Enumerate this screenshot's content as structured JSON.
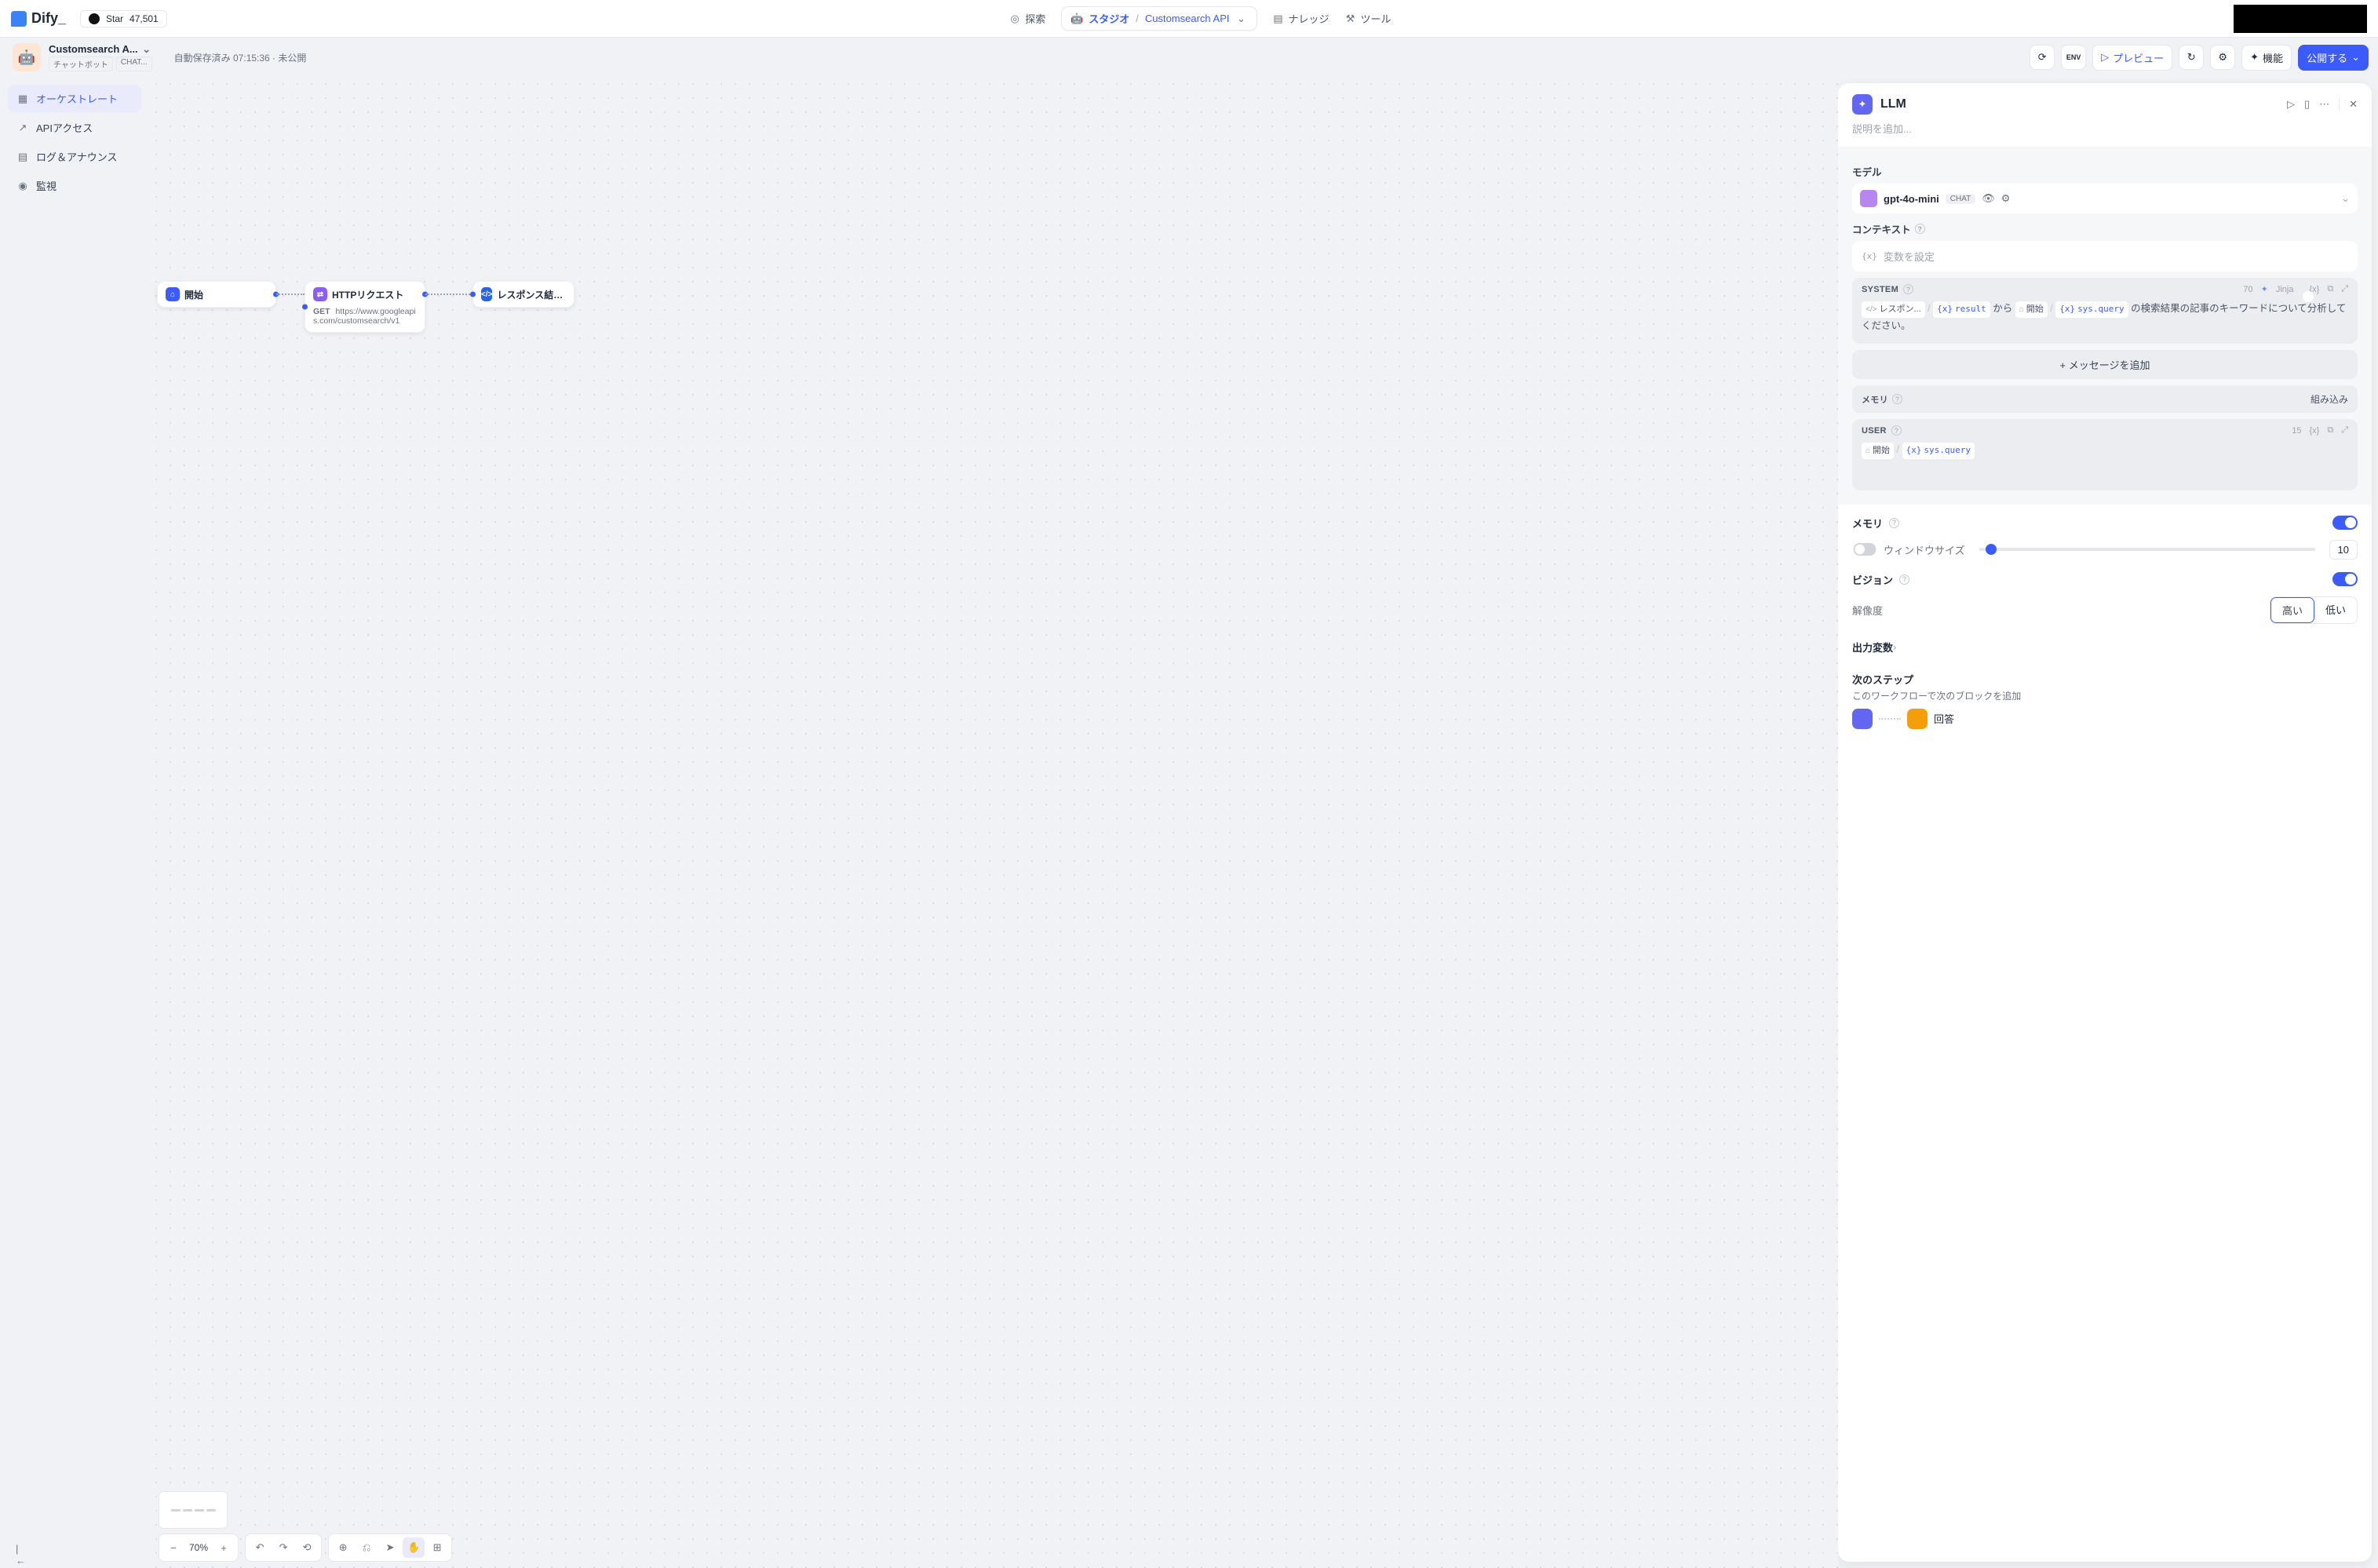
{
  "brand": "Dify_",
  "github": {
    "star_label": "Star",
    "count": "47,501"
  },
  "nav": {
    "explore": "探索",
    "studio": "スタジオ",
    "app_name": "Customsearch API",
    "knowledge": "ナレッジ",
    "tools": "ツール"
  },
  "app": {
    "title": "Customsearch A...",
    "tag1": "チャットボット",
    "tag2": "CHAT...",
    "save_status": "自動保存済み 07:15:36 · 未公開"
  },
  "actions": {
    "preview": "プレビュー",
    "features": "機能",
    "publish": "公開する"
  },
  "sidebar": {
    "items": [
      {
        "label": "オーケストレート"
      },
      {
        "label": "APIアクセス"
      },
      {
        "label": "ログ＆アナウンス"
      },
      {
        "label": "監視"
      }
    ]
  },
  "flow": {
    "start": "開始",
    "http": "HTTPリクエスト",
    "http_method": "GET",
    "http_url": "https://www.googleapis.com/customsearch/v1",
    "code": "レスポンス結果から必..."
  },
  "toolbar": {
    "zoom": "70%"
  },
  "panel": {
    "title": "LLM",
    "desc_placeholder": "説明を追加...",
    "model_label": "モデル",
    "model_name": "gpt-4o-mini",
    "model_chip": "CHAT",
    "context_label": "コンテキスト",
    "context_placeholder": "変数を設定",
    "system": {
      "role": "SYSTEM",
      "count": "70",
      "jinja": "Jinja",
      "ref_node": "レスポン...",
      "var1": "result",
      "txt1": " から ",
      "ref_start": "開始",
      "var2": "sys.query",
      "txt2": " の検索結果の記事のキーワードについて分析してください。"
    },
    "add_message": "メッセージを追加",
    "memory_label": "メモリ",
    "embedded": "組み込み",
    "user": {
      "role": "USER",
      "count": "15",
      "ref_start": "開始",
      "var": "sys.query"
    },
    "memory2_label": "メモリ",
    "window_size_label": "ウィンドウサイズ",
    "window_size_value": "10",
    "vision_label": "ビジョン",
    "resolution_label": "解像度",
    "res_high": "高い",
    "res_low": "低い",
    "output_label": "出力変数",
    "next_label": "次のステップ",
    "next_desc": "このワークフローで次のブロックを追加",
    "next_node": "回答"
  }
}
